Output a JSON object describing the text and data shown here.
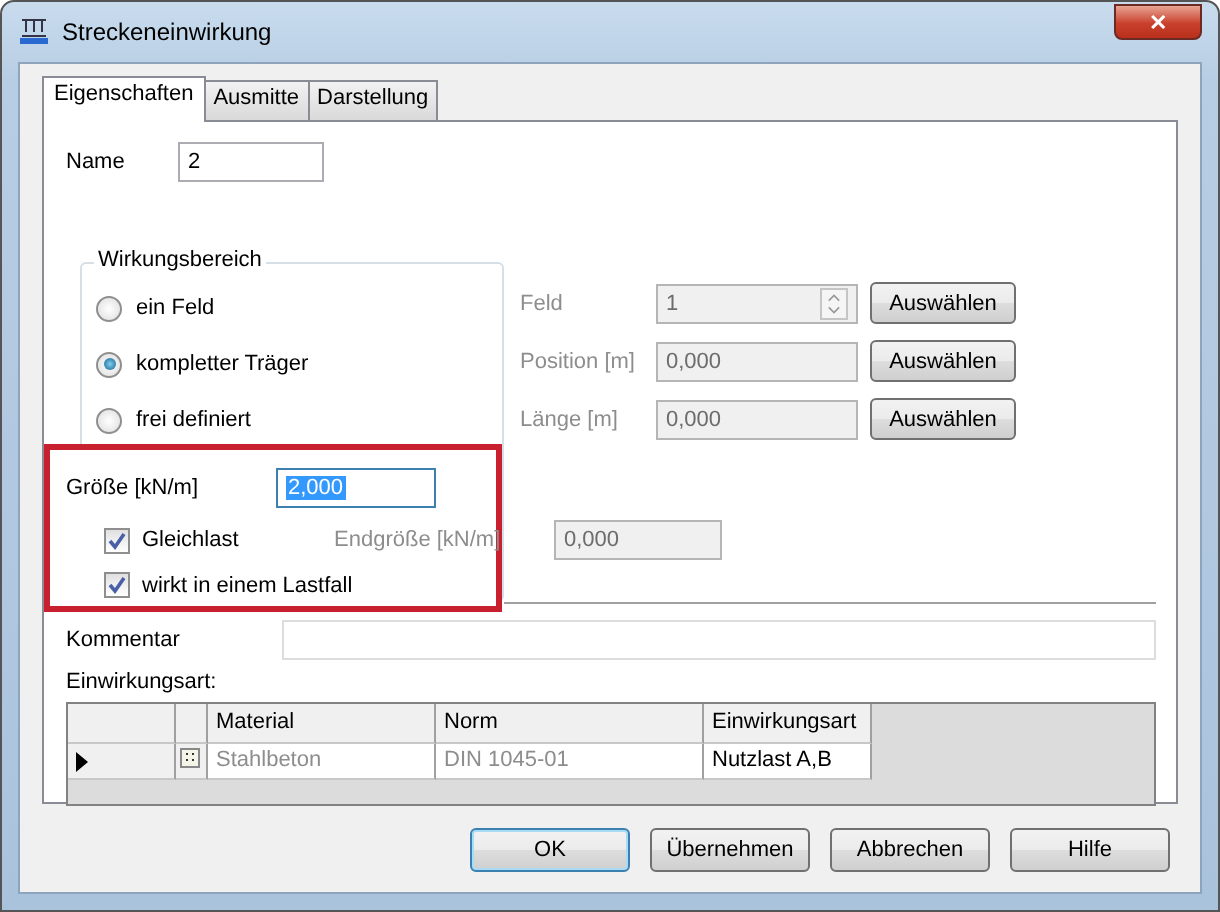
{
  "window": {
    "title": "Streckeneinwirkung",
    "close": "✕"
  },
  "tabs": [
    {
      "label": "Eigenschaften",
      "selected": true
    },
    {
      "label": "Ausmitte",
      "selected": false
    },
    {
      "label": "Darstellung",
      "selected": false
    }
  ],
  "name": {
    "label": "Name",
    "value": "2"
  },
  "wirkungsbereich": {
    "title": "Wirkungsbereich",
    "options": [
      {
        "label": "ein Feld",
        "selected": false
      },
      {
        "label": "kompletter Träger",
        "selected": true
      },
      {
        "label": "frei definiert",
        "selected": false
      }
    ]
  },
  "range_fields": [
    {
      "label": "Feld",
      "value": "1",
      "kind": "spinner",
      "disabled": true,
      "button": "Auswählen"
    },
    {
      "label": "Position [m]",
      "value": "0,000",
      "kind": "text",
      "disabled": true,
      "button": "Auswählen"
    },
    {
      "label": "Länge [m]",
      "value": "0,000",
      "kind": "text",
      "disabled": true,
      "button": "Auswählen"
    }
  ],
  "groesse": {
    "label": "Größe [kN/m]",
    "value": "2,000"
  },
  "checkboxes": [
    {
      "label": "Gleichlast",
      "checked": true
    },
    {
      "label": "wirkt in einem Lastfall",
      "checked": true
    }
  ],
  "endgroesse": {
    "label": "Endgröße [kN/m]",
    "value": "0,000",
    "disabled": true
  },
  "kommentar": {
    "label": "Kommentar"
  },
  "einwirkungsart_label": "Einwirkungsart:",
  "table": {
    "columns": [
      "Material",
      "Norm",
      "Einwirkungsart"
    ],
    "rows": [
      {
        "selected": true,
        "cells": [
          "Stahlbeton",
          "DIN 1045-01",
          "Nutzlast A,B"
        ]
      }
    ]
  },
  "buttons": [
    {
      "label": "OK",
      "default": true
    },
    {
      "label": "Übernehmen",
      "default": false
    },
    {
      "label": "Abbrechen",
      "default": false
    },
    {
      "label": "Hilfe",
      "default": false
    }
  ]
}
